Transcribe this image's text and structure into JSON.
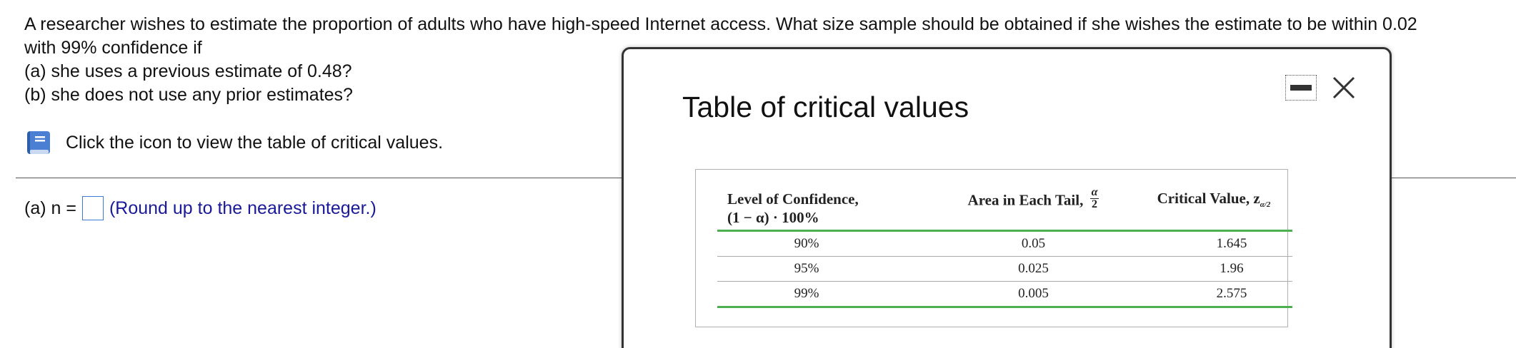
{
  "question": {
    "line1": "A researcher wishes to estimate the proportion of adults who have high-speed Internet access. What size sample should be obtained if she wishes the estimate to be within 0.02",
    "line2": "with 99% confidence if",
    "line3": "(a) she uses a previous estimate of 0.48?",
    "line4": "(b) she does not use any prior estimates?"
  },
  "hint": {
    "text": "Click the icon to view the table of critical values.",
    "icon": "book-icon"
  },
  "answer": {
    "label": "(a) n =",
    "value": "",
    "note": "(Round up to the nearest integer.)"
  },
  "modal": {
    "title": "Table of critical values",
    "minimize_icon": "minimize-icon",
    "close_icon": "close-icon",
    "table": {
      "headers": {
        "col1_line1": "Level of Confidence,",
        "col1_line2": "(1 − α) · 100%",
        "col2_text": "Area in Each Tail,",
        "col2_frac_num": "α",
        "col2_frac_den": "2",
        "col3_text": "Critical Value, z",
        "col3_sub": "α/2"
      },
      "rows": [
        {
          "confidence": "90%",
          "tail": "0.05",
          "critical": "1.645"
        },
        {
          "confidence": "95%",
          "tail": "0.025",
          "critical": "1.96"
        },
        {
          "confidence": "99%",
          "tail": "0.005",
          "critical": "2.575"
        }
      ]
    }
  },
  "colors": {
    "accent_green": "#4caf50",
    "input_border": "#3a7bd5",
    "hint_text": "#1a1a99",
    "book_icon": "#4a7fd4"
  }
}
